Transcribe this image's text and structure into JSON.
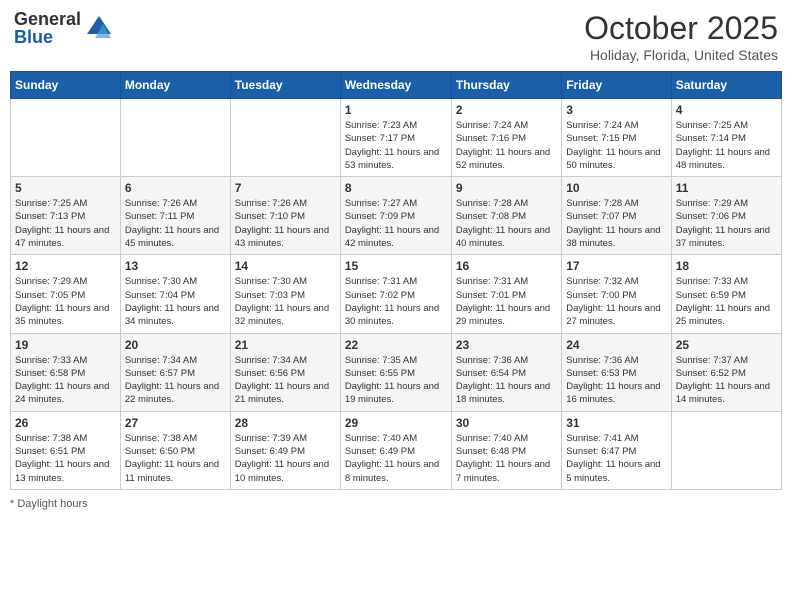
{
  "header": {
    "logo_general": "General",
    "logo_blue": "Blue",
    "month_title": "October 2025",
    "location": "Holiday, Florida, United States"
  },
  "weekdays": [
    "Sunday",
    "Monday",
    "Tuesday",
    "Wednesday",
    "Thursday",
    "Friday",
    "Saturday"
  ],
  "weeks": [
    [
      {
        "day": "",
        "sunrise": "",
        "sunset": "",
        "daylight": ""
      },
      {
        "day": "",
        "sunrise": "",
        "sunset": "",
        "daylight": ""
      },
      {
        "day": "",
        "sunrise": "",
        "sunset": "",
        "daylight": ""
      },
      {
        "day": "1",
        "sunrise": "Sunrise: 7:23 AM",
        "sunset": "Sunset: 7:17 PM",
        "daylight": "Daylight: 11 hours and 53 minutes."
      },
      {
        "day": "2",
        "sunrise": "Sunrise: 7:24 AM",
        "sunset": "Sunset: 7:16 PM",
        "daylight": "Daylight: 11 hours and 52 minutes."
      },
      {
        "day": "3",
        "sunrise": "Sunrise: 7:24 AM",
        "sunset": "Sunset: 7:15 PM",
        "daylight": "Daylight: 11 hours and 50 minutes."
      },
      {
        "day": "4",
        "sunrise": "Sunrise: 7:25 AM",
        "sunset": "Sunset: 7:14 PM",
        "daylight": "Daylight: 11 hours and 48 minutes."
      }
    ],
    [
      {
        "day": "5",
        "sunrise": "Sunrise: 7:25 AM",
        "sunset": "Sunset: 7:13 PM",
        "daylight": "Daylight: 11 hours and 47 minutes."
      },
      {
        "day": "6",
        "sunrise": "Sunrise: 7:26 AM",
        "sunset": "Sunset: 7:11 PM",
        "daylight": "Daylight: 11 hours and 45 minutes."
      },
      {
        "day": "7",
        "sunrise": "Sunrise: 7:26 AM",
        "sunset": "Sunset: 7:10 PM",
        "daylight": "Daylight: 11 hours and 43 minutes."
      },
      {
        "day": "8",
        "sunrise": "Sunrise: 7:27 AM",
        "sunset": "Sunset: 7:09 PM",
        "daylight": "Daylight: 11 hours and 42 minutes."
      },
      {
        "day": "9",
        "sunrise": "Sunrise: 7:28 AM",
        "sunset": "Sunset: 7:08 PM",
        "daylight": "Daylight: 11 hours and 40 minutes."
      },
      {
        "day": "10",
        "sunrise": "Sunrise: 7:28 AM",
        "sunset": "Sunset: 7:07 PM",
        "daylight": "Daylight: 11 hours and 38 minutes."
      },
      {
        "day": "11",
        "sunrise": "Sunrise: 7:29 AM",
        "sunset": "Sunset: 7:06 PM",
        "daylight": "Daylight: 11 hours and 37 minutes."
      }
    ],
    [
      {
        "day": "12",
        "sunrise": "Sunrise: 7:29 AM",
        "sunset": "Sunset: 7:05 PM",
        "daylight": "Daylight: 11 hours and 35 minutes."
      },
      {
        "day": "13",
        "sunrise": "Sunrise: 7:30 AM",
        "sunset": "Sunset: 7:04 PM",
        "daylight": "Daylight: 11 hours and 34 minutes."
      },
      {
        "day": "14",
        "sunrise": "Sunrise: 7:30 AM",
        "sunset": "Sunset: 7:03 PM",
        "daylight": "Daylight: 11 hours and 32 minutes."
      },
      {
        "day": "15",
        "sunrise": "Sunrise: 7:31 AM",
        "sunset": "Sunset: 7:02 PM",
        "daylight": "Daylight: 11 hours and 30 minutes."
      },
      {
        "day": "16",
        "sunrise": "Sunrise: 7:31 AM",
        "sunset": "Sunset: 7:01 PM",
        "daylight": "Daylight: 11 hours and 29 minutes."
      },
      {
        "day": "17",
        "sunrise": "Sunrise: 7:32 AM",
        "sunset": "Sunset: 7:00 PM",
        "daylight": "Daylight: 11 hours and 27 minutes."
      },
      {
        "day": "18",
        "sunrise": "Sunrise: 7:33 AM",
        "sunset": "Sunset: 6:59 PM",
        "daylight": "Daylight: 11 hours and 25 minutes."
      }
    ],
    [
      {
        "day": "19",
        "sunrise": "Sunrise: 7:33 AM",
        "sunset": "Sunset: 6:58 PM",
        "daylight": "Daylight: 11 hours and 24 minutes."
      },
      {
        "day": "20",
        "sunrise": "Sunrise: 7:34 AM",
        "sunset": "Sunset: 6:57 PM",
        "daylight": "Daylight: 11 hours and 22 minutes."
      },
      {
        "day": "21",
        "sunrise": "Sunrise: 7:34 AM",
        "sunset": "Sunset: 6:56 PM",
        "daylight": "Daylight: 11 hours and 21 minutes."
      },
      {
        "day": "22",
        "sunrise": "Sunrise: 7:35 AM",
        "sunset": "Sunset: 6:55 PM",
        "daylight": "Daylight: 11 hours and 19 minutes."
      },
      {
        "day": "23",
        "sunrise": "Sunrise: 7:36 AM",
        "sunset": "Sunset: 6:54 PM",
        "daylight": "Daylight: 11 hours and 18 minutes."
      },
      {
        "day": "24",
        "sunrise": "Sunrise: 7:36 AM",
        "sunset": "Sunset: 6:53 PM",
        "daylight": "Daylight: 11 hours and 16 minutes."
      },
      {
        "day": "25",
        "sunrise": "Sunrise: 7:37 AM",
        "sunset": "Sunset: 6:52 PM",
        "daylight": "Daylight: 11 hours and 14 minutes."
      }
    ],
    [
      {
        "day": "26",
        "sunrise": "Sunrise: 7:38 AM",
        "sunset": "Sunset: 6:51 PM",
        "daylight": "Daylight: 11 hours and 13 minutes."
      },
      {
        "day": "27",
        "sunrise": "Sunrise: 7:38 AM",
        "sunset": "Sunset: 6:50 PM",
        "daylight": "Daylight: 11 hours and 11 minutes."
      },
      {
        "day": "28",
        "sunrise": "Sunrise: 7:39 AM",
        "sunset": "Sunset: 6:49 PM",
        "daylight": "Daylight: 11 hours and 10 minutes."
      },
      {
        "day": "29",
        "sunrise": "Sunrise: 7:40 AM",
        "sunset": "Sunset: 6:49 PM",
        "daylight": "Daylight: 11 hours and 8 minutes."
      },
      {
        "day": "30",
        "sunrise": "Sunrise: 7:40 AM",
        "sunset": "Sunset: 6:48 PM",
        "daylight": "Daylight: 11 hours and 7 minutes."
      },
      {
        "day": "31",
        "sunrise": "Sunrise: 7:41 AM",
        "sunset": "Sunset: 6:47 PM",
        "daylight": "Daylight: 11 hours and 5 minutes."
      },
      {
        "day": "",
        "sunrise": "",
        "sunset": "",
        "daylight": ""
      }
    ]
  ],
  "footer": {
    "daylight_label": "Daylight hours"
  }
}
